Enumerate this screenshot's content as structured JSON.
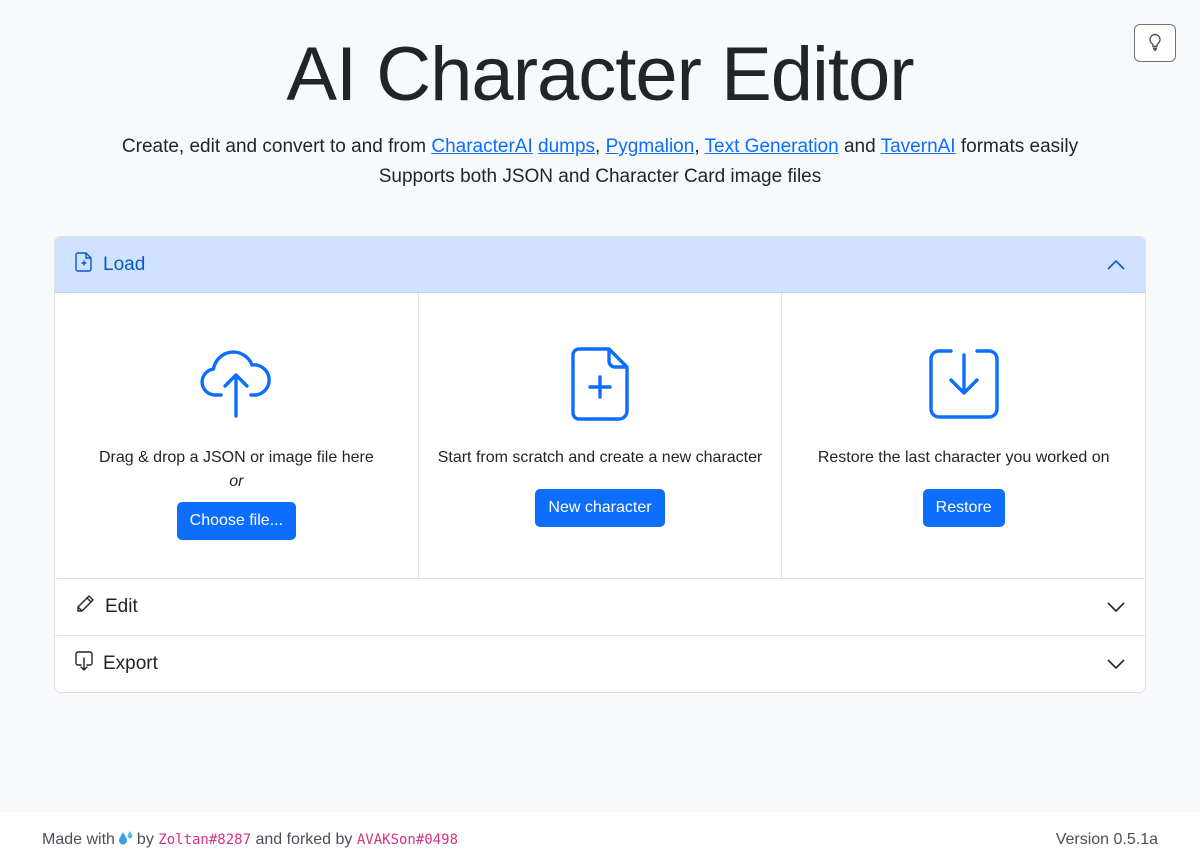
{
  "header": {
    "title": "AI Character Editor",
    "subtitle_line1": {
      "prefix": "Create, edit and convert to and from ",
      "link1": "CharacterAI",
      "link2": "dumps",
      "sep1": ", ",
      "link3": "Pygmalion",
      "sep2": ", ",
      "link4": "Text Generation",
      "mid": " and ",
      "link5": "TavernAI",
      "suffix": " formats easily"
    },
    "subtitle_line2": "Supports both JSON and Character Card image files",
    "theme_toggle_icon": "lightbulb-icon"
  },
  "accordion": {
    "load": {
      "label": "Load",
      "icon": "file-plus-icon",
      "expanded": true,
      "columns": [
        {
          "icon": "cloud-upload-icon",
          "description": "Drag & drop a JSON or image file here",
          "or_text": "or",
          "button": "Choose file..."
        },
        {
          "icon": "file-plus-icon",
          "description": "Start from scratch and create a new character",
          "button": "New character"
        },
        {
          "icon": "download-box-icon",
          "description": "Restore the last character you worked on",
          "button": "Restore"
        }
      ]
    },
    "edit": {
      "label": "Edit",
      "icon": "pencil-icon",
      "expanded": false
    },
    "export": {
      "label": "Export",
      "icon": "file-export-icon",
      "expanded": false
    }
  },
  "footer": {
    "made_with": "Made with",
    "by": "by",
    "author": "Zoltan#8287",
    "forked_by": "and forked by",
    "forker": "AVAKSon#0498",
    "version": "Version 0.5.1a"
  },
  "colors": {
    "accent": "#0d6efd",
    "accordion_open_bg": "#cfe2ff",
    "code_pink": "#d63384"
  }
}
